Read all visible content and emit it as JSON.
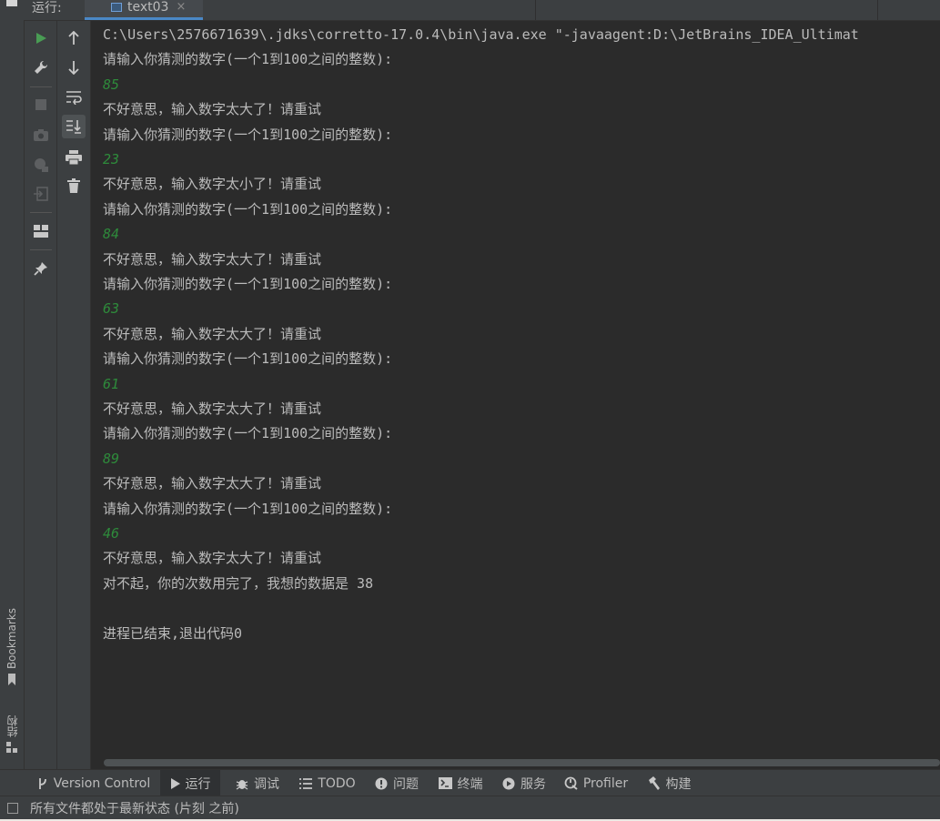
{
  "header": {
    "run_label": "运行:",
    "tab_label": "text03",
    "tab_close": "×"
  },
  "left_stripe": {
    "bookmarks_label": "Bookmarks",
    "structure_label": "结构"
  },
  "console": {
    "lines": [
      {
        "text": "C:\\Users\\2576671639\\.jdks\\corretto-17.0.4\\bin\\java.exe \"-javaagent:D:\\JetBrains_IDEA_Ultimat",
        "type": "out"
      },
      {
        "text": "请输入你猜测的数字(一个1到100之间的整数):",
        "type": "out"
      },
      {
        "text": "85",
        "type": "in"
      },
      {
        "text": "不好意思，输入数字太大了！请重试",
        "type": "out"
      },
      {
        "text": "请输入你猜测的数字(一个1到100之间的整数):",
        "type": "out"
      },
      {
        "text": "23",
        "type": "in"
      },
      {
        "text": "不好意思，输入数字太小了！请重试",
        "type": "out"
      },
      {
        "text": "请输入你猜测的数字(一个1到100之间的整数):",
        "type": "out"
      },
      {
        "text": "84",
        "type": "in"
      },
      {
        "text": "不好意思，输入数字太大了！请重试",
        "type": "out"
      },
      {
        "text": "请输入你猜测的数字(一个1到100之间的整数):",
        "type": "out"
      },
      {
        "text": "63",
        "type": "in"
      },
      {
        "text": "不好意思，输入数字太大了！请重试",
        "type": "out"
      },
      {
        "text": "请输入你猜测的数字(一个1到100之间的整数):",
        "type": "out"
      },
      {
        "text": "61",
        "type": "in"
      },
      {
        "text": "不好意思，输入数字太大了！请重试",
        "type": "out"
      },
      {
        "text": "请输入你猜测的数字(一个1到100之间的整数):",
        "type": "out"
      },
      {
        "text": "89",
        "type": "in"
      },
      {
        "text": "不好意思，输入数字太大了！请重试",
        "type": "out"
      },
      {
        "text": "请输入你猜测的数字(一个1到100之间的整数):",
        "type": "out"
      },
      {
        "text": "46",
        "type": "in"
      },
      {
        "text": "不好意思，输入数字太大了！请重试",
        "type": "out"
      },
      {
        "text": "对不起，你的次数用完了，我想的数据是 38",
        "type": "out"
      },
      {
        "text": "",
        "type": "out"
      },
      {
        "text": "进程已结束,退出代码0",
        "type": "out"
      }
    ]
  },
  "bottom_bar": {
    "items": [
      {
        "label": "Version Control",
        "icon": "branch-icon"
      },
      {
        "label": "运行",
        "icon": "play-icon"
      },
      {
        "label": "调试",
        "icon": "bug-icon"
      },
      {
        "label": "TODO",
        "icon": "list-icon"
      },
      {
        "label": "问题",
        "icon": "info-icon"
      },
      {
        "label": "终端",
        "icon": "terminal-icon"
      },
      {
        "label": "服务",
        "icon": "service-icon"
      },
      {
        "label": "Profiler",
        "icon": "profiler-icon"
      },
      {
        "label": "构建",
        "icon": "hammer-icon"
      }
    ]
  },
  "status_bar": {
    "text": "所有文件都处于最新状态 (片刻 之前)"
  },
  "colors": {
    "accent": "#4a88c7",
    "run_green": "#499c54",
    "input_green": "#2e8b3b",
    "panel": "#3c3f41",
    "editor": "#2b2b2b"
  }
}
